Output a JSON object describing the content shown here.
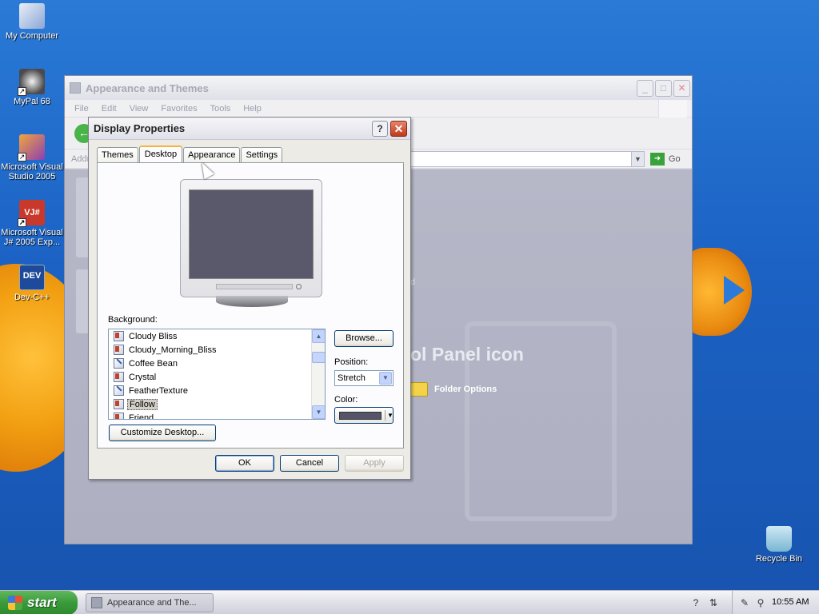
{
  "desktop": {
    "icons": [
      {
        "label": "My Computer"
      },
      {
        "label": "MyPal 68"
      },
      {
        "label": "Microsoft Visual Studio 2005"
      },
      {
        "label": "Microsoft Visual J# 2005 Exp..."
      },
      {
        "label": "Dev-C++"
      },
      {
        "label": "Recycle Bin"
      }
    ]
  },
  "explorer": {
    "title": "Appearance and Themes",
    "menu": [
      "File",
      "Edit",
      "View",
      "Favorites",
      "Tools",
      "Help"
    ],
    "address_label": "Addr",
    "go_label": "Go",
    "pane_heading": "ol Panel icon",
    "pane_fragment": "d",
    "folder_options_label": "Folder Options"
  },
  "dialog": {
    "title": "Display Properties",
    "help_label": "?",
    "close_label": "✕",
    "tabs": [
      "Themes",
      "Desktop",
      "Appearance",
      "Settings"
    ],
    "active_tab": "Desktop",
    "background_label": "Background:",
    "backgrounds": [
      {
        "name": "Cloudy Bliss",
        "icon": "image-icon"
      },
      {
        "name": "Cloudy_Morning_Bliss",
        "icon": "image-icon"
      },
      {
        "name": "Coffee Bean",
        "icon": "paint-icon"
      },
      {
        "name": "Crystal",
        "icon": "image-icon"
      },
      {
        "name": "FeatherTexture",
        "icon": "paint-icon"
      },
      {
        "name": "Follow",
        "icon": "image-icon"
      },
      {
        "name": "Friend",
        "icon": "image-icon"
      }
    ],
    "selected_background": "Follow",
    "browse_label": "Browse...",
    "position_label": "Position:",
    "position_value": "Stretch",
    "color_label": "Color:",
    "color_value": "#55546a",
    "customize_label": "Customize Desktop...",
    "ok_label": "OK",
    "cancel_label": "Cancel",
    "apply_label": "Apply"
  },
  "taskbar": {
    "start_label": "start",
    "task_label": "Appearance and The...",
    "clock": "10:55 AM"
  }
}
